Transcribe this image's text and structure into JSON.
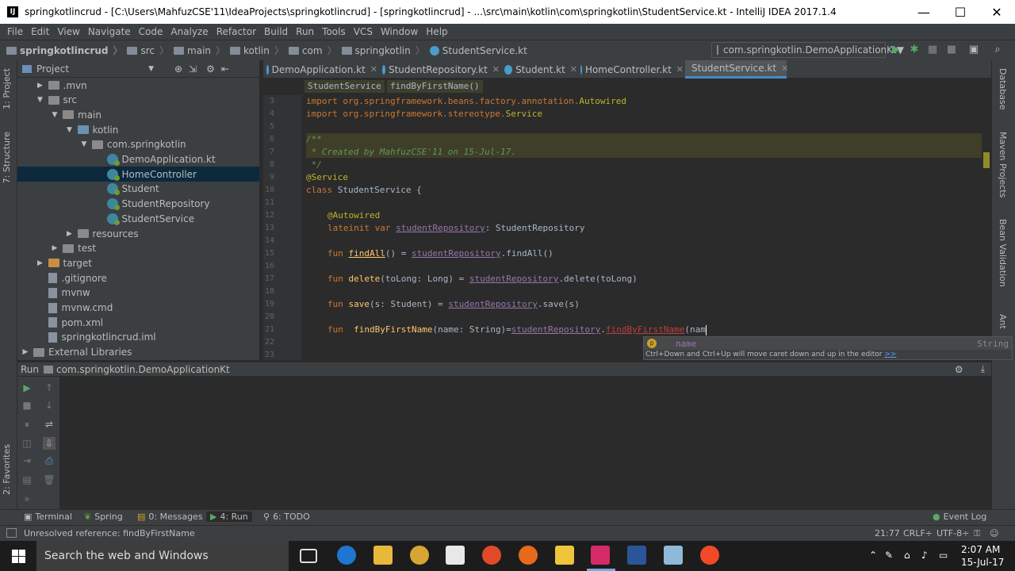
{
  "window": {
    "title": "springkotlincrud - [C:\\Users\\MahfuzCSE'11\\IdeaProjects\\springkotlincrud] - [springkotlincrud] - ...\\src\\main\\kotlin\\com\\springkotlin\\StudentService.kt - IntelliJ IDEA 2017.1.4",
    "app_icon": "IJ",
    "minimize": "—",
    "maximize": "☐",
    "close": "✕"
  },
  "menu": [
    "File",
    "Edit",
    "View",
    "Navigate",
    "Code",
    "Analyze",
    "Refactor",
    "Build",
    "Run",
    "Tools",
    "VCS",
    "Window",
    "Help"
  ],
  "navbar": {
    "crumbs": [
      "springkotlincrud",
      "src",
      "main",
      "kotlin",
      "com",
      "springkotlin",
      "StudentService.kt"
    ],
    "run_config": "com.springkotlin.DemoApplicationKt"
  },
  "left_strip": {
    "project": "1: Project",
    "structure": "7: Structure",
    "favorites": "2: Favorites"
  },
  "right_strip": {
    "database": "Database",
    "maven": "Maven Projects",
    "bean": "Bean Validation",
    "ant": "Ant"
  },
  "project": {
    "header": "Project",
    "tree": [
      {
        "label": ".mvn",
        "depth": 1,
        "type": "folder",
        "arrow": "▶"
      },
      {
        "label": "src",
        "depth": 1,
        "type": "folder",
        "arrow": "▼"
      },
      {
        "label": "main",
        "depth": 2,
        "type": "folder",
        "arrow": "▼"
      },
      {
        "label": "kotlin",
        "depth": 3,
        "type": "folder-src",
        "arrow": "▼"
      },
      {
        "label": "com.springkotlin",
        "depth": 4,
        "type": "folder",
        "arrow": "▼"
      },
      {
        "label": "DemoApplication.kt",
        "depth": 5,
        "type": "kotlin"
      },
      {
        "label": "HomeController",
        "depth": 5,
        "type": "kotlin",
        "selected": true
      },
      {
        "label": "Student",
        "depth": 5,
        "type": "kotlin"
      },
      {
        "label": "StudentRepository",
        "depth": 5,
        "type": "kotlin"
      },
      {
        "label": "StudentService",
        "depth": 5,
        "type": "kotlin"
      },
      {
        "label": "resources",
        "depth": 3,
        "type": "folder",
        "arrow": "▶"
      },
      {
        "label": "test",
        "depth": 2,
        "type": "folder",
        "arrow": "▶"
      },
      {
        "label": "target",
        "depth": 1,
        "type": "folder-orange",
        "arrow": "▶"
      },
      {
        "label": ".gitignore",
        "depth": 1,
        "type": "file"
      },
      {
        "label": "mvnw",
        "depth": 1,
        "type": "file"
      },
      {
        "label": "mvnw.cmd",
        "depth": 1,
        "type": "file"
      },
      {
        "label": "pom.xml",
        "depth": 1,
        "type": "file"
      },
      {
        "label": "springkotlincrud.iml",
        "depth": 1,
        "type": "file"
      },
      {
        "label": "External Libraries",
        "depth": 0,
        "type": "lib",
        "arrow": "▶"
      }
    ]
  },
  "tabs": [
    {
      "label": "DemoApplication.kt",
      "active": false
    },
    {
      "label": "StudentRepository.kt",
      "active": false
    },
    {
      "label": "Student.kt",
      "active": false
    },
    {
      "label": "HomeController.kt",
      "active": false
    },
    {
      "label": "StudentService.kt",
      "active": true
    }
  ],
  "editor_breadcrumb": [
    "StudentService",
    "findByFirstName()"
  ],
  "code": {
    "line_numbers": [
      "3",
      "4",
      "5",
      "6",
      "7",
      "8",
      "9",
      "10",
      "11",
      "12",
      "13",
      "14",
      "15",
      "16",
      "17",
      "18",
      "19",
      "20",
      "21",
      "22",
      "23"
    ],
    "l3a": "import org.springframework.beans.factory.annotation.",
    "l3b": "Autowired",
    "l4a": "import org.springframework.stereotype.",
    "l4b": "Service",
    "l6": "/**",
    "l7": " * Created by MahfuzCSE'11 on 15-Jul-17.",
    "l8": " */",
    "l9": "@Service",
    "l10a": "class",
    "l10b": " StudentService {",
    "l12": "@Autowired",
    "l13a": "lateinit var ",
    "l13b": "studentRepository",
    "l13c": ": StudentRepository",
    "l15a": "fun ",
    "l15b": "findAll",
    "l15c": "() = ",
    "l15d": "studentRepository",
    "l15e": ".findAll()",
    "l17a": "fun ",
    "l17b": "delete",
    "l17c": "(toLong: Long) = ",
    "l17d": "studentRepository",
    "l17e": ".delete(toLong)",
    "l19a": "fun ",
    "l19b": "save",
    "l19c": "(s: Student) = ",
    "l19d": "studentRepository",
    "l19e": ".save(s)",
    "l21a": "fun  ",
    "l21b": "findByFirstName",
    "l21c": "(name: String)=",
    "l21d": "studentRepository",
    "l21e": ".",
    "l21f": "findByFirstName",
    "l21g": "(nam"
  },
  "completion": {
    "param_icon": "p",
    "item": "name",
    "type": "String",
    "hint": "Ctrl+Down and Ctrl+Up will move caret down and up in the editor",
    "hint_link": ">>"
  },
  "run_panel": {
    "label": "Run",
    "config": "com.springkotlin.DemoApplicationKt"
  },
  "bottom_tabs": [
    {
      "label": "Terminal"
    },
    {
      "label": "Spring"
    },
    {
      "label": "0: Messages"
    },
    {
      "label": "4: Run"
    },
    {
      "label": "6: TODO"
    }
  ],
  "event_log": "Event Log",
  "status": {
    "message": "Unresolved reference: findByFirstName",
    "position": "21:77",
    "line_sep": "CRLF÷",
    "encoding": "UTF-8÷"
  },
  "taskbar": {
    "search_placeholder": "Search the web and Windows",
    "time": "2:07 AM",
    "date": "15-Jul-17"
  },
  "colors": {
    "keyword": "#cc7832",
    "annotation": "#bbb529",
    "comment": "#629755",
    "field": "#9876aa",
    "function": "#ffc66d",
    "error": "#bc3f3c",
    "selection": "#0d293e"
  }
}
